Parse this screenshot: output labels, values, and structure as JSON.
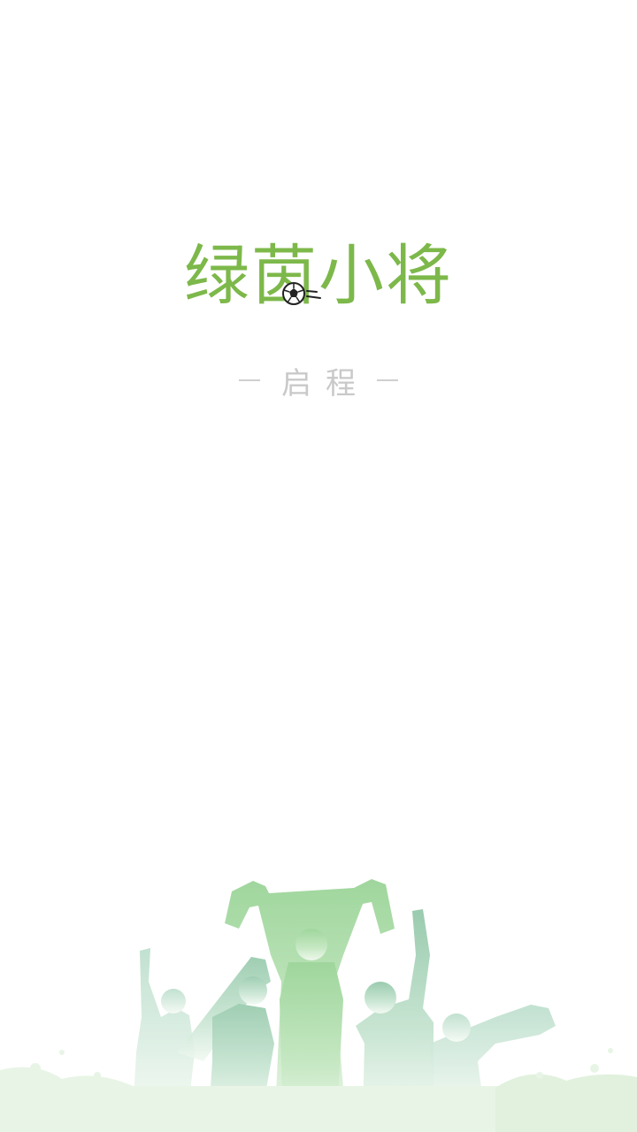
{
  "app": {
    "title_chars": [
      "绿",
      "茵",
      "小",
      "将"
    ],
    "subtitle": "启程"
  },
  "colors": {
    "brand": "#7db84a",
    "subtitle": "#c9c9c9",
    "silhouette_top": "#9fd69c",
    "silhouette_bottom": "#e4f3e2"
  },
  "icons": {
    "logo_ball": "soccer-ball-icon",
    "illustration": "cheering-fans-silhouette"
  }
}
